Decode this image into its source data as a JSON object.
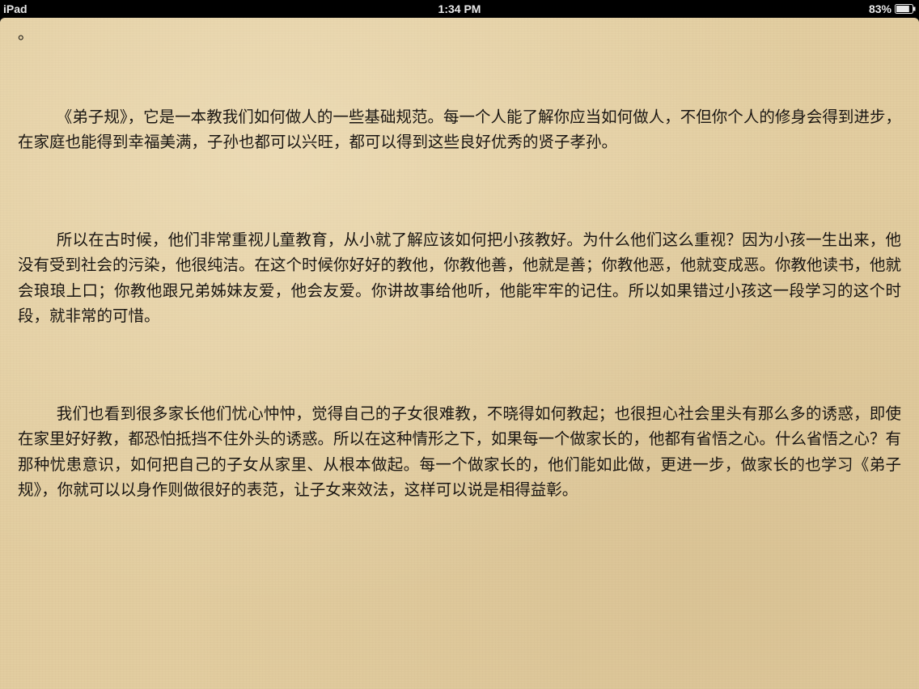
{
  "status_bar": {
    "device": "iPad",
    "time": "1:34 PM",
    "battery": "83%",
    "battery_level": 0.83,
    "battery_icon": "battery-icon"
  },
  "reader": {
    "stray_text": "。",
    "paragraphs": [
      "《弟子规》，它是一本教我们如何做人的一些基础规范。每一个人能了解你应当如何做人，不但你个人的修身会得到进步，在家庭也能得到幸福美满，子孙也都可以兴旺，都可以得到这些良好优秀的贤子孝孙。",
      "所以在古时候，他们非常重视儿童教育，从小就了解应该如何把小孩教好。为什么他们这么重视？因为小孩一生出来，他没有受到社会的污染，他很纯洁。在这个时候你好好的教他，你教他善，他就是善；你教他恶，他就变成恶。你教他读书，他就会琅琅上口；你教他跟兄弟姊妹友爱，他会友爱。你讲故事给他听，他能牢牢的记住。所以如果错过小孩这一段学习的这个时段，就非常的可惜。",
      "我们也看到很多家长他们忧心忡忡，觉得自己的子女很难教，不晓得如何教起；也很担心社会里头有那么多的诱惑，即使在家里好好教，都恐怕抵挡不住外头的诱惑。所以在这种情形之下，如果每一个做家长的，他都有省悟之心。什么省悟之心？有那种忧患意识，如何把自己的子女从家里、从根本做起。每一个做家长的，他们能如此做，更进一步，做家长的也学习《弟子规》，你就可以以身作则做很好的表范，让子女来效法，这样可以说是相得益彰。"
    ]
  }
}
